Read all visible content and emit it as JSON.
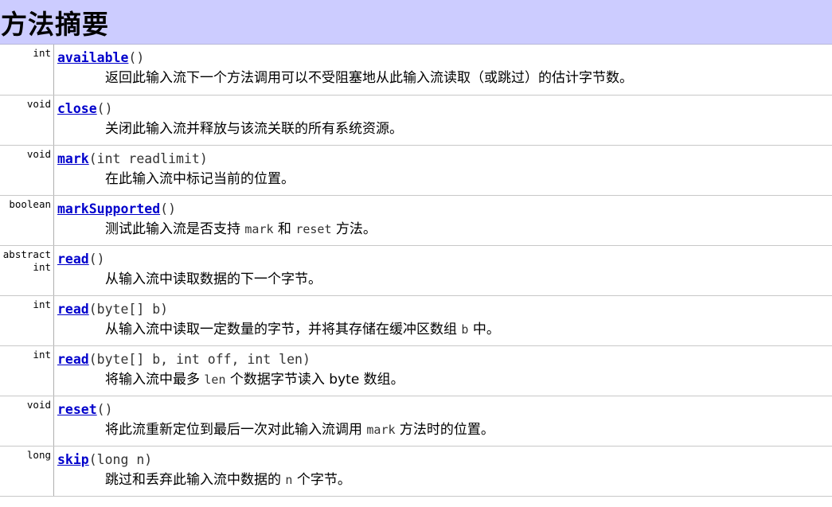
{
  "header": {
    "title": "方法摘要"
  },
  "methods": [
    {
      "type": "int",
      "name": "available",
      "params": "()",
      "desc": [
        {
          "t": "返回此输入流下一个方法调用可以不受阻塞地从此输入流读取（或跳过）的估计字节数。"
        }
      ]
    },
    {
      "type": "void",
      "name": "close",
      "params": "()",
      "desc": [
        {
          "t": "关闭此输入流并释放与该流关联的所有系统资源。"
        }
      ]
    },
    {
      "type": "void",
      "name": "mark",
      "params": "(int readlimit)",
      "desc": [
        {
          "t": "在此输入流中标记当前的位置。"
        }
      ]
    },
    {
      "type": "boolean",
      "name": "markSupported",
      "params": "()",
      "desc": [
        {
          "t": "测试此输入流是否支持 "
        },
        {
          "c": "mark"
        },
        {
          "t": " 和 "
        },
        {
          "c": "reset"
        },
        {
          "t": " 方法。"
        }
      ]
    },
    {
      "type": "abstract\nint",
      "name": "read",
      "params": "()",
      "desc": [
        {
          "t": "从输入流中读取数据的下一个字节。"
        }
      ]
    },
    {
      "type": "int",
      "name": "read",
      "params": "(byte[] b)",
      "desc": [
        {
          "t": "从输入流中读取一定数量的字节，并将其存储在缓冲区数组 "
        },
        {
          "c": "b"
        },
        {
          "t": " 中。"
        }
      ]
    },
    {
      "type": "int",
      "name": "read",
      "params": "(byte[] b, int off, int len)",
      "desc": [
        {
          "t": "将输入流中最多 "
        },
        {
          "c": "len"
        },
        {
          "t": " 个数据字节读入 byte 数组。"
        }
      ]
    },
    {
      "type": "void",
      "name": "reset",
      "params": "()",
      "desc": [
        {
          "t": "将此流重新定位到最后一次对此输入流调用 "
        },
        {
          "c": "mark"
        },
        {
          "t": " 方法时的位置。"
        }
      ]
    },
    {
      "type": "long",
      "name": "skip",
      "params": "(long n)",
      "desc": [
        {
          "t": "跳过和丢弃此输入流中数据的 "
        },
        {
          "c": "n"
        },
        {
          "t": " 个字节。"
        }
      ]
    }
  ]
}
